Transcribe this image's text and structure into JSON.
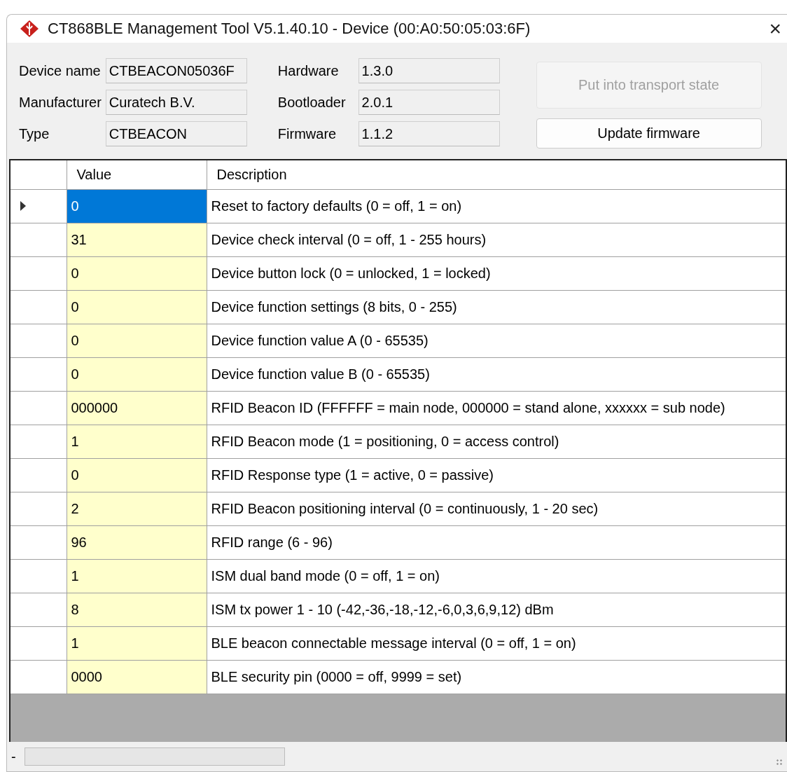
{
  "window": {
    "title": "CT868BLE Management Tool V5.1.40.10 - Device (00:A0:50:05:03:6F)",
    "close": "×"
  },
  "fields": [
    {
      "label": "Device name",
      "value": "CTBEACON05036F"
    },
    {
      "label": "Manufacturer",
      "value": "Curatech B.V."
    },
    {
      "label": "Type",
      "value": "CTBEACON"
    },
    {
      "label": "Hardware",
      "value": "1.3.0"
    },
    {
      "label": "Bootloader",
      "value": "2.0.1"
    },
    {
      "label": "Firmware",
      "value": "1.1.2"
    }
  ],
  "buttons": [
    {
      "label": "Put into transport state",
      "disabled": true
    },
    {
      "label": "Update firmware",
      "disabled": false
    }
  ],
  "table": {
    "columns": [
      "Value",
      "Description"
    ],
    "rows": [
      {
        "value": "0",
        "description": "Reset to factory defaults (0 = off, 1 = on)",
        "selected": true
      },
      {
        "value": "31",
        "description": "Device check interval (0 = off, 1 - 255 hours)",
        "selected": false
      },
      {
        "value": "0",
        "description": "Device button lock (0 = unlocked, 1 = locked)",
        "selected": false
      },
      {
        "value": "0",
        "description": "Device function settings (8 bits, 0 - 255)",
        "selected": false
      },
      {
        "value": "0",
        "description": "Device function value A (0 - 65535)",
        "selected": false
      },
      {
        "value": "0",
        "description": "Device function value B (0 - 65535)",
        "selected": false
      },
      {
        "value": "000000",
        "description": "RFID Beacon ID (FFFFFF = main node, 000000 = stand alone, xxxxxx = sub node)",
        "selected": false
      },
      {
        "value": "1",
        "description": "RFID Beacon mode (1 = positioning, 0 = access control)",
        "selected": false
      },
      {
        "value": "0",
        "description": "RFID Response type (1 = active, 0 = passive)",
        "selected": false
      },
      {
        "value": "2",
        "description": "RFID Beacon positioning interval (0 = continuously, 1 - 20 sec)",
        "selected": false
      },
      {
        "value": "96",
        "description": "RFID range (6 - 96)",
        "selected": false
      },
      {
        "value": "1",
        "description": "ISM dual band mode (0 = off, 1 = on)",
        "selected": false
      },
      {
        "value": "8",
        "description": "ISM tx power 1 - 10 (-42,-36,-18,-12,-6,0,3,6,9,12) dBm",
        "selected": false
      },
      {
        "value": "1",
        "description": "BLE beacon connectable message interval (0 = off, 1 = on)",
        "selected": false
      },
      {
        "value": "0000",
        "description": "BLE security pin (0000 = off, 9999 = set)",
        "selected": false
      }
    ]
  },
  "status_bar": {
    "text": "-",
    "progress": {
      "level": 0
    }
  }
}
